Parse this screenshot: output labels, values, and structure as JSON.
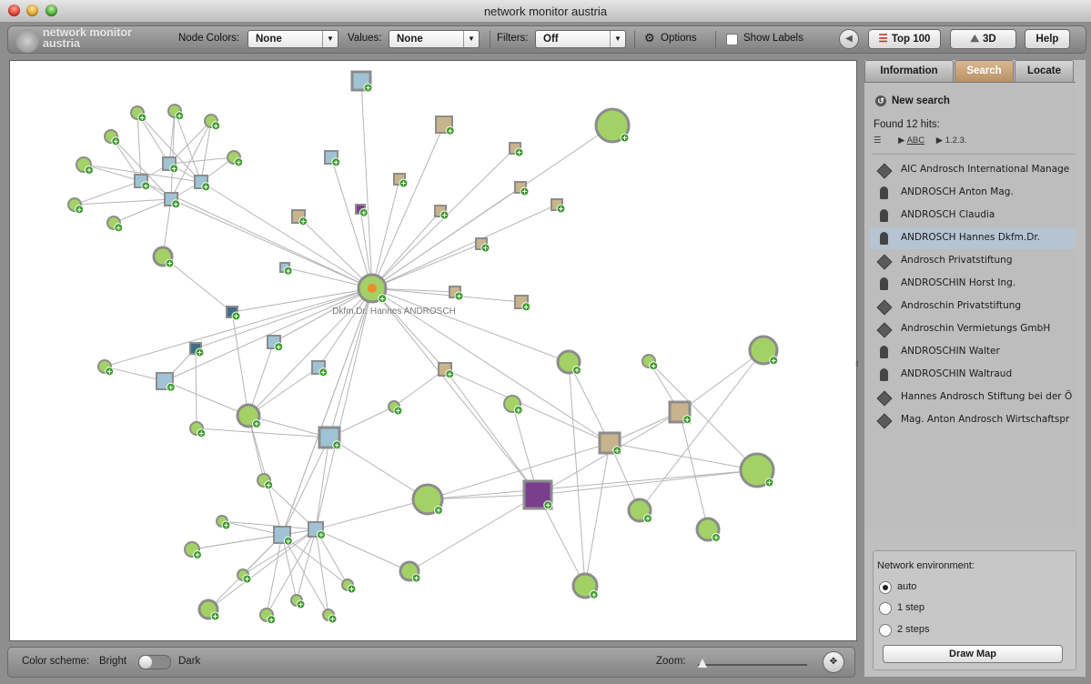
{
  "window": {
    "title": "network monitor austria"
  },
  "toolbar": {
    "logo_line1": "network monitor",
    "logo_line2": "austria",
    "node_colors_label": "Node Colors:",
    "node_colors_value": "None",
    "values_label": "Values:",
    "values_value": "None",
    "filters_label": "Filters:",
    "filters_value": "Off",
    "options_label": "Options",
    "show_labels_label": "Show Labels",
    "top100_label": "Top 100",
    "threed_label": "3D",
    "help_label": "Help"
  },
  "graph": {
    "center_label": "Dkfm.Dr. Hannes ANDROSCH",
    "colors": {
      "green": "#a3d165",
      "blue": "#9fc3d4",
      "tan": "#c8b48c",
      "purple": "#7a3e8e",
      "teal": "#3f6f86",
      "edge": "#b5b5b5",
      "center_dot": "#f08a2a"
    }
  },
  "sidebar": {
    "tabs": [
      "Information",
      "Search",
      "Locate"
    ],
    "active_tab": "Search",
    "new_search_label": "New search",
    "hits_text": "Found 12 hits:",
    "sort_abc": "ABC",
    "sort_num": "1.2.3.",
    "results": [
      {
        "type": "org",
        "label": "AIC Androsch International Manage"
      },
      {
        "type": "person",
        "label": "ANDROSCH Anton Mag."
      },
      {
        "type": "person",
        "label": "ANDROSCH Claudia"
      },
      {
        "type": "person",
        "label": "ANDROSCH Hannes Dkfm.Dr.",
        "selected": true
      },
      {
        "type": "org",
        "label": "Androsch Privatstiftung"
      },
      {
        "type": "person",
        "label": "ANDROSCHIN Horst Ing."
      },
      {
        "type": "org",
        "label": "Androschin Privatstiftung"
      },
      {
        "type": "org",
        "label": "Androschin Vermietungs GmbH"
      },
      {
        "type": "person",
        "label": "ANDROSCHIN Walter"
      },
      {
        "type": "person",
        "label": "ANDROSCHIN Waltraud"
      },
      {
        "type": "org",
        "label": "Hannes Androsch Stiftung bei der Ö"
      },
      {
        "type": "org",
        "label": "Mag. Anton Androsch Wirtschaftspr"
      }
    ],
    "env": {
      "title": "Network environment:",
      "options": [
        "auto",
        "1 step",
        "2 steps"
      ],
      "selected": "auto",
      "draw_label": "Draw Map"
    }
  },
  "bottom": {
    "scheme_label": "Color scheme:",
    "bright_label": "Bright",
    "dark_label": "Dark",
    "zoom_label": "Zoom:"
  }
}
